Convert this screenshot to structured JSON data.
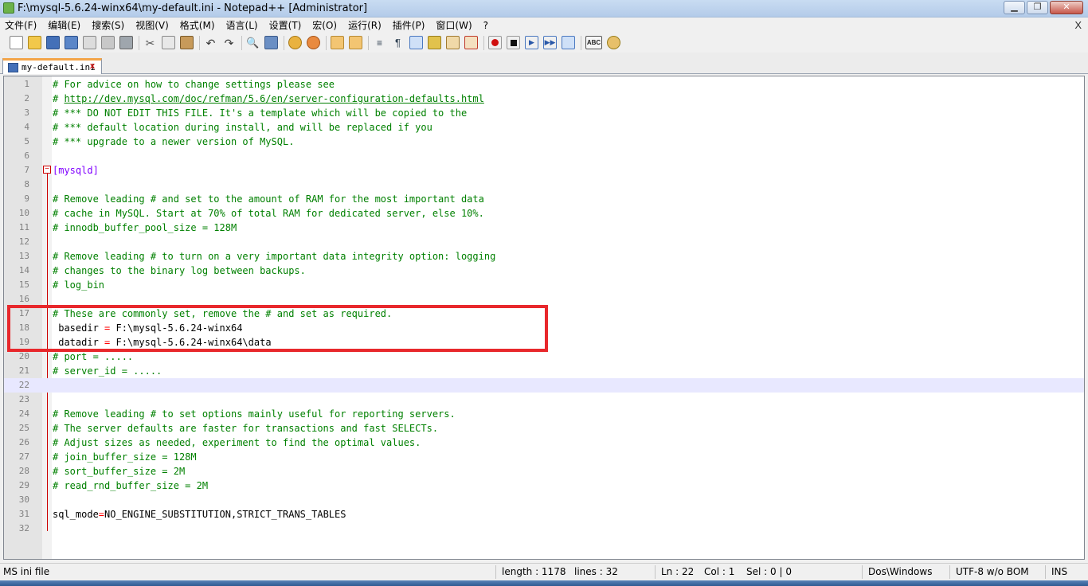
{
  "window": {
    "title": "F:\\mysql-5.6.24-winx64\\my-default.ini - Notepad++ [Administrator]",
    "minimize": "▁",
    "maximize": "❐",
    "close": "✕"
  },
  "menu": {
    "items": [
      "文件(F)",
      "编辑(E)",
      "搜索(S)",
      "视图(V)",
      "格式(M)",
      "语言(L)",
      "设置(T)",
      "宏(O)",
      "运行(R)",
      "插件(P)",
      "窗口(W)",
      "?"
    ],
    "close": "X"
  },
  "toolbar": {
    "icons": [
      "new-file-icon",
      "open-file-icon",
      "save-icon",
      "save-all-icon",
      "close-file-icon",
      "close-all-icon",
      "print-icon",
      "cut-icon",
      "copy-icon",
      "paste-icon",
      "undo-icon",
      "redo-icon",
      "find-icon",
      "replace-icon",
      "zoom-in-icon",
      "zoom-out-icon",
      "sync-vertical-icon",
      "sync-horizontal-icon",
      "word-wrap-icon",
      "show-all-chars-icon",
      "indent-guide-icon",
      "user-language-icon",
      "doc-map-icon",
      "function-list-icon",
      "record-macro-icon",
      "stop-record-icon",
      "play-macro-icon",
      "run-macro-multiple-icon",
      "save-macro-icon",
      "spellcheck-icon",
      "plugin-icon"
    ],
    "spellcheck_label": "ABC"
  },
  "tab": {
    "label": "my-default.ini",
    "close": "x"
  },
  "editor": {
    "active_line": 22,
    "lines": [
      {
        "n": "1",
        "text": "# For advice on how to change settings please see",
        "type": "comment"
      },
      {
        "n": "2",
        "text": "# http://dev.mysql.com/doc/refman/5.6/en/server-configuration-defaults.html",
        "type": "link"
      },
      {
        "n": "3",
        "text": "# *** DO NOT EDIT THIS FILE. It's a template which will be copied to the",
        "type": "comment"
      },
      {
        "n": "4",
        "text": "# *** default location during install, and will be replaced if you",
        "type": "comment"
      },
      {
        "n": "5",
        "text": "# *** upgrade to a newer version of MySQL.",
        "type": "comment"
      },
      {
        "n": "6",
        "text": "",
        "type": "comment"
      },
      {
        "n": "7",
        "text": "[mysqld]",
        "type": "section"
      },
      {
        "n": "8",
        "text": "",
        "type": "comment"
      },
      {
        "n": "9",
        "text": "# Remove leading # and set to the amount of RAM for the most important data",
        "type": "comment"
      },
      {
        "n": "10",
        "text": "# cache in MySQL. Start at 70% of total RAM for dedicated server, else 10%.",
        "type": "comment"
      },
      {
        "n": "11",
        "text": "# innodb_buffer_pool_size = 128M",
        "type": "comment"
      },
      {
        "n": "12",
        "text": "",
        "type": "comment"
      },
      {
        "n": "13",
        "text": "# Remove leading # to turn on a very important data integrity option: logging",
        "type": "comment"
      },
      {
        "n": "14",
        "text": "# changes to the binary log between backups.",
        "type": "comment"
      },
      {
        "n": "15",
        "text": "# log_bin",
        "type": "comment"
      },
      {
        "n": "16",
        "text": "",
        "type": "comment"
      },
      {
        "n": "17",
        "text": "# These are commonly set, remove the # and set as required.",
        "type": "comment"
      },
      {
        "n": "18",
        "text": " basedir = F:\\mysql-5.6.24-winx64",
        "type": "kv"
      },
      {
        "n": "19",
        "text": " datadir = F:\\mysql-5.6.24-winx64\\data",
        "type": "kv"
      },
      {
        "n": "20",
        "text": "# port = .....",
        "type": "comment"
      },
      {
        "n": "21",
        "text": "# server_id = .....",
        "type": "comment"
      },
      {
        "n": "22",
        "text": "",
        "type": "comment"
      },
      {
        "n": "23",
        "text": "",
        "type": "comment"
      },
      {
        "n": "24",
        "text": "# Remove leading # to set options mainly useful for reporting servers.",
        "type": "comment"
      },
      {
        "n": "25",
        "text": "# The server defaults are faster for transactions and fast SELECTs.",
        "type": "comment"
      },
      {
        "n": "26",
        "text": "# Adjust sizes as needed, experiment to find the optimal values.",
        "type": "comment"
      },
      {
        "n": "27",
        "text": "# join_buffer_size = 128M",
        "type": "comment"
      },
      {
        "n": "28",
        "text": "# sort_buffer_size = 2M",
        "type": "comment"
      },
      {
        "n": "29",
        "text": "# read_rnd_buffer_size = 2M",
        "type": "comment"
      },
      {
        "n": "30",
        "text": "",
        "type": "comment"
      },
      {
        "n": "31",
        "text": "sql_mode=NO_ENGINE_SUBSTITUTION,STRICT_TRANS_TABLES",
        "type": "kv"
      },
      {
        "n": "32",
        "text": "",
        "type": "comment"
      }
    ]
  },
  "status": {
    "filetype": "MS ini file",
    "length": "length : 1178",
    "lines": "lines : 32",
    "ln": "Ln : 22",
    "col": "Col : 1",
    "sel": "Sel : 0 | 0",
    "eol": "Dos\\Windows",
    "encoding": "UTF-8 w/o BOM",
    "mode": "INS"
  }
}
